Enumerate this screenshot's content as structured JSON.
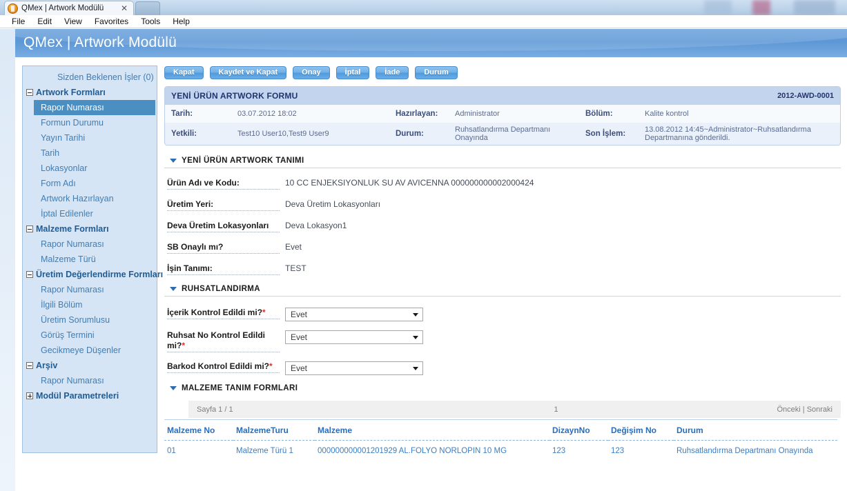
{
  "browser": {
    "tab_title": "QMex | Artwork Modülü",
    "close_label": "✕",
    "menu": [
      "File",
      "Edit",
      "View",
      "Favorites",
      "Tools",
      "Help"
    ]
  },
  "app": {
    "title": "QMex | Artwork Modülü"
  },
  "sidebar": {
    "items": [
      {
        "label": "Sizden Beklenen İşler (0)",
        "level": "plain",
        "expander": null,
        "selected": false
      },
      {
        "label": "Artwork Formları",
        "level": "lvl0",
        "expander": "minus",
        "selected": false
      },
      {
        "label": "Rapor Numarası",
        "level": "lvl1",
        "expander": null,
        "selected": true
      },
      {
        "label": "Formun Durumu",
        "level": "lvl1",
        "expander": null,
        "selected": false
      },
      {
        "label": "Yayın Tarihi",
        "level": "lvl1",
        "expander": null,
        "selected": false
      },
      {
        "label": "Tarih",
        "level": "lvl1",
        "expander": null,
        "selected": false
      },
      {
        "label": "Lokasyonlar",
        "level": "lvl1",
        "expander": null,
        "selected": false
      },
      {
        "label": "Form Adı",
        "level": "lvl1",
        "expander": null,
        "selected": false
      },
      {
        "label": "Artwork Hazırlayan",
        "level": "lvl1",
        "expander": null,
        "selected": false
      },
      {
        "label": "İptal Edilenler",
        "level": "lvl1",
        "expander": null,
        "selected": false
      },
      {
        "label": "Malzeme Formları",
        "level": "lvl0",
        "expander": "minus",
        "selected": false
      },
      {
        "label": "Rapor Numarası",
        "level": "lvl1",
        "expander": null,
        "selected": false
      },
      {
        "label": "Malzeme Türü",
        "level": "lvl1",
        "expander": null,
        "selected": false
      },
      {
        "label": "Üretim Değerlendirme Formları",
        "level": "lvl0",
        "expander": "minus",
        "selected": false
      },
      {
        "label": "Rapor Numarası",
        "level": "lvl1",
        "expander": null,
        "selected": false
      },
      {
        "label": "İlgili Bölüm",
        "level": "lvl1",
        "expander": null,
        "selected": false
      },
      {
        "label": "Üretim Sorumlusu",
        "level": "lvl1",
        "expander": null,
        "selected": false
      },
      {
        "label": "Görüş Termini",
        "level": "lvl1",
        "expander": null,
        "selected": false
      },
      {
        "label": "Gecikmeye Düşenler",
        "level": "lvl1",
        "expander": null,
        "selected": false
      },
      {
        "label": "Arşiv",
        "level": "lvl0",
        "expander": "minus",
        "selected": false
      },
      {
        "label": "Rapor Numarası",
        "level": "lvl1",
        "expander": null,
        "selected": false
      },
      {
        "label": "Modül Parametreleri",
        "level": "lvl0",
        "expander": "plus",
        "selected": false
      }
    ]
  },
  "toolbar": {
    "buttons": [
      {
        "label": "Kapat"
      },
      {
        "label": "Kaydet ve Kapat"
      },
      {
        "label": "Onay"
      },
      {
        "label": "İptal"
      },
      {
        "label": "İade"
      },
      {
        "label": "Durum"
      }
    ]
  },
  "form_header": {
    "title": "YENİ ÜRÜN ARTWORK FORMU",
    "number": "2012-AWD-0001",
    "row1": {
      "label1": "Tarih:",
      "value1": "03.07.2012 18:02",
      "label2": "Hazırlayan:",
      "value2": "Administrator",
      "label3": "Bölüm:",
      "value3": "Kalite kontrol"
    },
    "row2": {
      "label1": "Yetkili:",
      "value1": "Test10 User10,Test9 User9",
      "label2": "Durum:",
      "value2": "Ruhsatlandırma Departmanı Onayında",
      "label3": "Son İşlem:",
      "value3": "13.08.2012 14:45~Administrator~Ruhsatlandırma Departmanına gönderildi."
    }
  },
  "section_tanim": {
    "title": "YENİ ÜRÜN ARTWORK TANIMI",
    "rows": [
      {
        "label": "Ürün Adı ve Kodu:",
        "value": "10 CC ENJEKSIYONLUK SU AV AVICENNA   000000000002000424"
      },
      {
        "label": "Üretim Yeri:",
        "value": "Deva Üretim Lokasyonları"
      },
      {
        "label": "Deva Üretim Lokasyonları",
        "value": "Deva Lokasyon1"
      },
      {
        "label": "SB Onaylı mı?",
        "value": "Evet"
      },
      {
        "label": "İşin Tanımı:",
        "value": "TEST"
      }
    ]
  },
  "section_ruhsat": {
    "title": "RUHSATLANDIRMA",
    "rows": [
      {
        "label": "İçerik Kontrol Edildi mi?",
        "required": "*",
        "value": "Evet"
      },
      {
        "label": "Ruhsat No Kontrol Edildi mi?",
        "required": "*",
        "value": "Evet"
      },
      {
        "label": "Barkod Kontrol Edildi mi?",
        "required": "*",
        "value": "Evet"
      }
    ]
  },
  "section_malzeme": {
    "title": "MALZEME TANIM FORMLARI",
    "pager": {
      "page": "Sayfa 1 / 1",
      "current": "1",
      "nav": "Önceki | Sonraki"
    },
    "columns": [
      "Malzeme No",
      "MalzemeTuru",
      "Malzeme",
      "DizaynNo",
      "Değişim No",
      "Durum"
    ],
    "rows": [
      {
        "malzeme_no": "01",
        "malzeme_turu": "Malzeme Türü 1",
        "malzeme": "000000000001201929 AL.FOLYO NORLOPIN 10 MG",
        "dizayn_no": "123",
        "degisim_no": "123",
        "durum": "Ruhsatlandırma Departmanı Onayında"
      }
    ]
  }
}
